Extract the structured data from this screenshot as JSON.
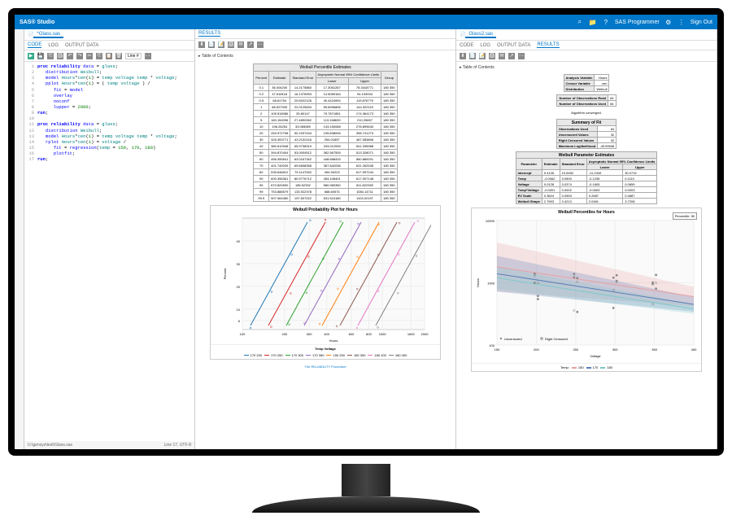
{
  "app": {
    "title": "SAS® Studio",
    "user": "SAS Programmer",
    "signout": "Sign Out"
  },
  "leftPanel": {
    "fileTab": "*Glass.sas",
    "tabs": {
      "code": "CODE",
      "log": "LOG",
      "output": "OUTPUT DATA"
    },
    "activeTab": "CODE",
    "lineLabel": "Line #",
    "code": [
      "proc reliability data = glass;",
      "   distribution Weibull;",
      "   model Hours*cen(1) = temp voltage temp * voltage;",
      "   pplot Hours*cen(1) = ( temp voltage ) /",
      "      fit = model",
      "      overlay",
      "      noconf",
      "      lupper = 2000;",
      "run;",
      "",
      "proc reliability data = glass;",
      "   distribution Weibull;",
      "   model Hours*cen(1) = temp voltage temp * voltage;",
      "   rplot Hours*cen(1) = voltage /",
      "      fit = regression(temp = 150, 170, 180)",
      "      plotfit;",
      "run;"
    ],
    "statusLeft": "U:\\gensys\\test\\Glass.sas",
    "statusRight": "Line 17,   UTF-8"
  },
  "midPanel": {
    "tabs": {
      "results": "RESULTS"
    },
    "toc": "Table of Contents",
    "percentileTable": {
      "title": "Weibull Percentile Estimates",
      "subheader": "Asymptotic Normal 95% Confidence Limits",
      "cols": [
        "Percent",
        "Estimate",
        "Standard Error",
        "Lower",
        "Upper",
        "Group"
      ],
      "rows": [
        [
          "0.1",
          "36.004200",
          "14.2175860",
          "17.3061267",
          "78.3418771",
          "180 350"
        ],
        [
          "0.2",
          "47.618118",
          "16.1376993",
          "14.5089184",
          "94.103934",
          "180 350"
        ],
        [
          "0.5",
          "68.81754",
          "20.6022126",
          "40.4424994",
          "119.876779",
          "180 350"
        ],
        [
          "1",
          "88.527939",
          "22.0125634",
          "55.6596806",
          "144.322115",
          "180 350"
        ],
        [
          "2",
          "109.518086",
          "25.80147",
          "79.7871851",
          "174.364173",
          "180 350"
        ],
        [
          "5",
          "160.154096",
          "27.4892062",
          "113.168639",
          "210.25657",
          "180 350"
        ],
        [
          "10",
          "196.25254",
          "33.065089",
          "143.150068",
          "278.899640",
          "180 350"
        ],
        [
          "20",
          "263.972798",
          "50.1937434",
          "195.838006",
          "398.741273",
          "180 350"
        ],
        [
          "30",
          "325.393771",
          "43.2132118",
          "254.01857",
          "467.083806",
          "180 350"
        ],
        [
          "40",
          "380.610948",
          "55.9738319",
          "333.012539",
          "541.335988",
          "180 350"
        ],
        [
          "50",
          "394.870404",
          "53.0004512",
          "362.567505",
          "513.328071",
          "180 350"
        ],
        [
          "60",
          "456.395541",
          "63.0167262",
          "448.688433",
          "560.889201",
          "180 350"
        ],
        [
          "70",
          "401.740039",
          "69.6838358",
          "367.842036",
          "631.262535",
          "180 350"
        ],
        [
          "80",
          "535.646812",
          "79.1147260",
          "454.90223",
          "617.997244",
          "180 350"
        ],
        [
          "90",
          "600.396361",
          "80.9776712",
          "454.108401",
          "617.007148",
          "180 350"
        ],
        [
          "95",
          "670.820690",
          "185.52332",
          "580.980350",
          "811.822390",
          "180 350"
        ],
        [
          "99",
          "753.888579",
          "133.922378",
          "668.60574",
          "1084.14711",
          "180 350"
        ],
        [
          "99.9",
          "907.064360",
          "197.607022",
          "631.524180",
          "1104.02197",
          "180 350"
        ]
      ]
    },
    "procFooter": "The RELIABILITY Procedure"
  },
  "rightPanel": {
    "fileTab": "Glass2.sas",
    "tabs": {
      "code": "CODE",
      "log": "LOG",
      "output": "OUTPUT DATA",
      "results": "RESULTS"
    },
    "activeTab": "RESULTS",
    "toc": "Table of Contents",
    "infoTable": {
      "rows": [
        [
          "Analysis Variable",
          "Hours"
        ],
        [
          "Censor Variable",
          "cen"
        ],
        [
          "Distribution",
          "Weibull"
        ]
      ]
    },
    "obsTable": {
      "rows": [
        [
          "Number of Observations Read",
          "64"
        ],
        [
          "Number of Observations Used",
          "64"
        ]
      ]
    },
    "converged": "Algorithm converged.",
    "fitTable": {
      "title": "Summary of Fit",
      "rows": [
        [
          "Observations Used",
          "64"
        ],
        [
          "Uncensored Values",
          "32"
        ],
        [
          "Right Censored Values",
          "32"
        ],
        [
          "Maximum Loglikelihood",
          "-45.99546"
        ]
      ]
    },
    "paramTable": {
      "title": "Weibull Parameter Estimates",
      "subheader": "Asymptotic Normal 95% Confidence Limits",
      "cols": [
        "Parameter",
        "Estimate",
        "Standard Error",
        "Lower",
        "Upper"
      ],
      "rows": [
        [
          "Intercept",
          "9.4135",
          "10.5452",
          "-11.2349",
          "30.0719"
        ],
        [
          "Temp",
          "-0.0062",
          "0.0500",
          "-0.1235",
          "0.1110"
        ],
        [
          "Voltage",
          "0.0128",
          "0.0374",
          "-0.1605",
          "0.0859"
        ],
        [
          "Temp*Voltage",
          "-0.0001",
          "0.0002",
          "-0.0003",
          "0.0003"
        ],
        [
          "EV Scale",
          "0.3624",
          "0.0553",
          "0.2687",
          "0.4887"
        ],
        [
          "Weibull Shape",
          "2.7593",
          "0.4213",
          "2.0461",
          "3.7208"
        ]
      ]
    }
  },
  "chart_data": [
    {
      "type": "line",
      "title": "Weibull Probability Plot for Hours",
      "xlabel": "Hours",
      "ylabel": "Percent",
      "xlim": [
        100,
        2000
      ],
      "ylim": [
        1,
        50
      ],
      "xticks": [
        100,
        200,
        300,
        400,
        600,
        800,
        1000,
        1600,
        2000
      ],
      "yticks": [
        5,
        10,
        20,
        30,
        40
      ],
      "legend_title": "Temp Voltage",
      "series": [
        {
          "name": "170 200",
          "color": "#1f77b4"
        },
        {
          "name": "170 250",
          "color": "#d62728"
        },
        {
          "name": "170 300",
          "color": "#2ca02c"
        },
        {
          "name": "170 350",
          "color": "#9467bd"
        },
        {
          "name": "150 250",
          "color": "#ff7f0e"
        },
        {
          "name": "150 300",
          "color": "#8c564b"
        },
        {
          "name": "180 200",
          "color": "#e377c2"
        },
        {
          "name": "180 300",
          "color": "#7f7f7f"
        }
      ]
    },
    {
      "type": "line",
      "title": "Weibull Percentiles for Hours",
      "xlabel": "Voltage",
      "ylabel": "Hours",
      "xlim": [
        150,
        400
      ],
      "ylim": [
        100,
        10000
      ],
      "xticks": [
        150,
        200,
        250,
        300,
        350,
        400
      ],
      "yticks": [
        100,
        1000,
        10000
      ],
      "percentile_label": "Percentile: 50",
      "point_legend": [
        "Uncensored",
        "Right Censored"
      ],
      "legend_title": "Temp",
      "series": [
        {
          "name": "150",
          "color": "#e8a0a0",
          "values": [
            [
              150,
              1800
            ],
            [
              400,
              600
            ]
          ]
        },
        {
          "name": "170",
          "color": "#5a7db8",
          "values": [
            [
              150,
              1400
            ],
            [
              400,
              450
            ]
          ]
        },
        {
          "name": "180",
          "color": "#7ec9c9",
          "values": [
            [
              150,
              1200
            ],
            [
              400,
              380
            ]
          ]
        }
      ]
    }
  ]
}
